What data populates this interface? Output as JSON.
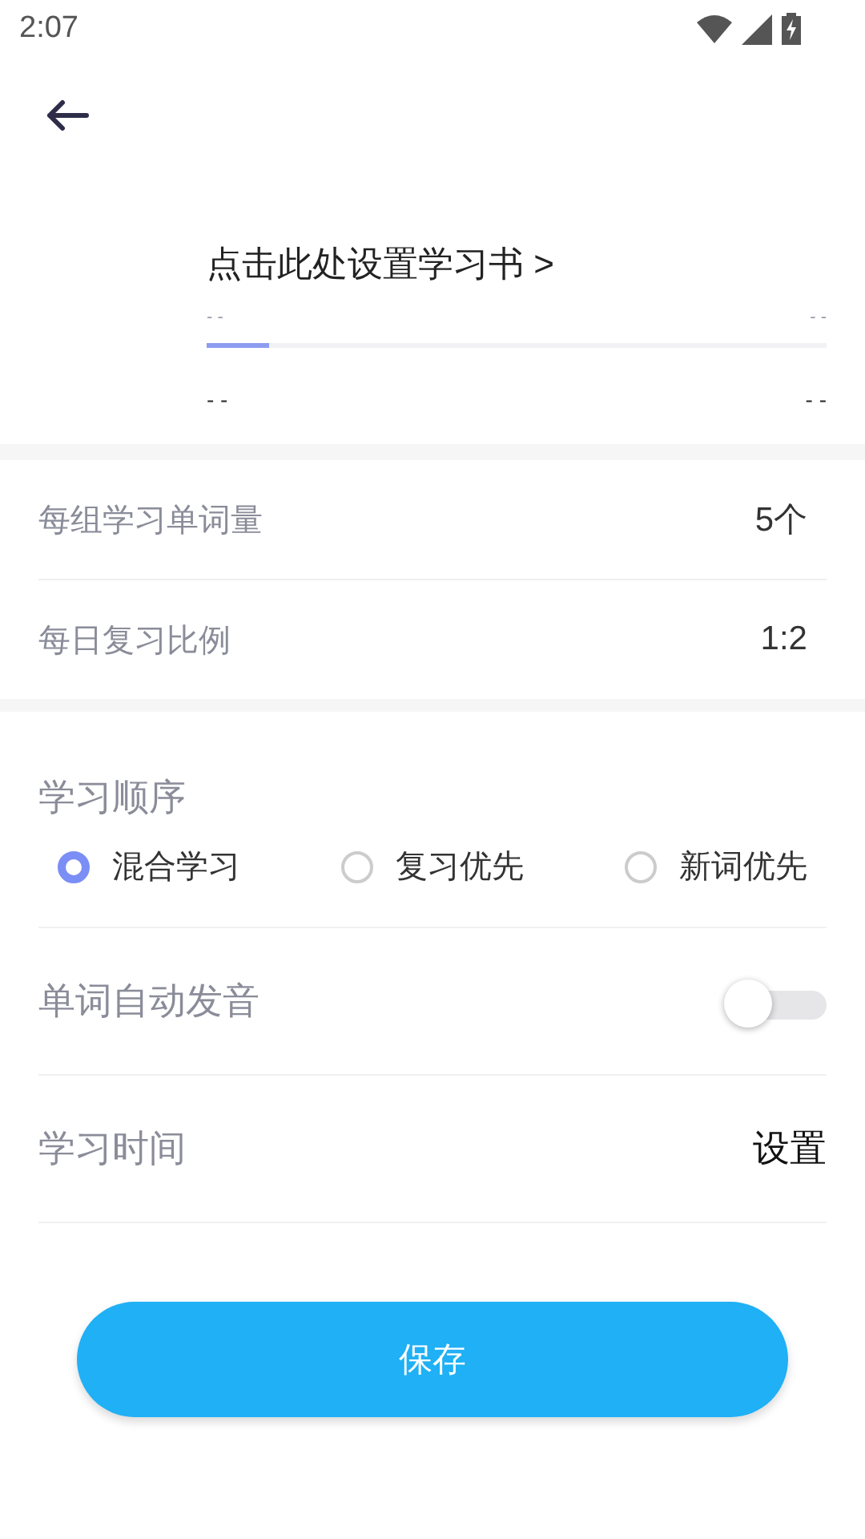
{
  "status_bar": {
    "time": "2:07"
  },
  "book": {
    "title": "点击此处设置学习书 >",
    "top_left": "- -",
    "top_right": "- -",
    "level": 0.1,
    "bottom_left": "- -",
    "bottom_right": "- -"
  },
  "settings": [
    {
      "label": "每组学习单词量",
      "value": "5个"
    },
    {
      "label": "每日复习比例",
      "value": "1:2"
    }
  ],
  "order": {
    "title": "学习顺序",
    "options": [
      {
        "label": "混合学习",
        "selected": true
      },
      {
        "label": "复习优先",
        "selected": false
      },
      {
        "label": "新词优先",
        "selected": false
      }
    ]
  },
  "auto_pronounce": {
    "label": "单词自动发音",
    "on": false
  },
  "study_time": {
    "label": "学习时间",
    "action": "设置"
  },
  "save_button": "保存"
}
